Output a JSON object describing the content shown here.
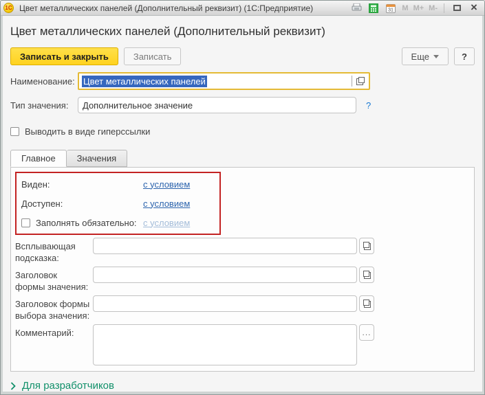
{
  "window": {
    "logo_text": "1С",
    "title": "Цвет металлических панелей (Дополнительный реквизит)  (1С:Предприятие)",
    "calendar_day": "31",
    "memory_buttons": {
      "m": "M",
      "m_plus": "M+",
      "m_minus": "M-"
    }
  },
  "header": {
    "title": "Цвет металлических панелей (Дополнительный реквизит)"
  },
  "toolbar": {
    "save_and_close": "Записать и закрыть",
    "save": "Записать",
    "more": "Еще",
    "help": "?"
  },
  "form": {
    "name_label": "Наименование:",
    "name_value": "Цвет металлических панелей",
    "type_label": "Тип значения:",
    "type_value": "Дополнительное значение",
    "type_help": "?",
    "hyperlink_label": "Выводить в виде гиперссылки"
  },
  "tabs": {
    "main": "Главное",
    "values": "Значения"
  },
  "main_tab": {
    "visible_label": "Виден:",
    "visible_link": "с условием",
    "accessible_label": "Доступен:",
    "accessible_link": "с условием",
    "required_label": "Заполнять обязательно:",
    "required_link": "с условием",
    "tooltip_label_line1": "Всплывающая",
    "tooltip_label_line2": "подсказка:",
    "value_form_label_line1": "Заголовок",
    "value_form_label_line2": "формы значения:",
    "choice_form_label_line1": "Заголовок формы",
    "choice_form_label_line2": "выбора значения:",
    "comment_label": "Комментарий:",
    "comment_more": "..."
  },
  "footer": {
    "developers": "Для разработчиков"
  },
  "colors": {
    "accent_yellow": "#ffd21f",
    "focus_border": "#e4ba35",
    "selection_blue": "#3667be",
    "link_blue": "#2b63ad",
    "disabled_link": "#a3bcd9",
    "annotation_red": "#c32222",
    "green_link": "#11906a"
  }
}
